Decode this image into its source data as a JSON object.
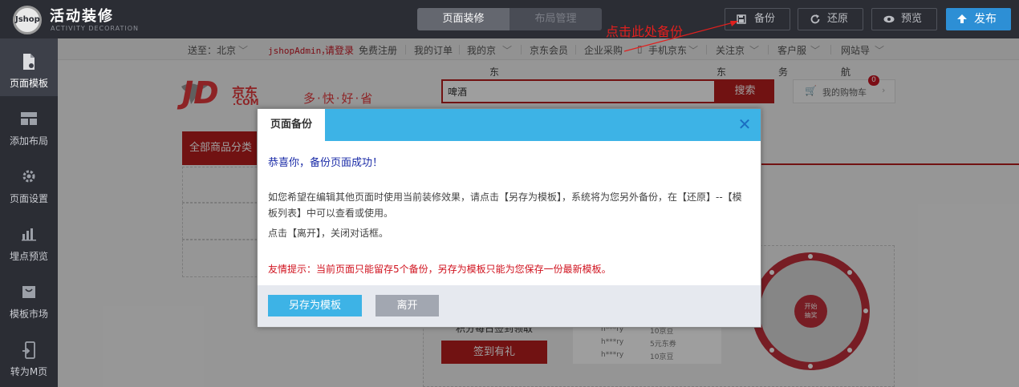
{
  "app": {
    "logo_text": "Jshop",
    "title": "活动装修",
    "subtitle": "ACTIVITY DECORATION"
  },
  "mode_tabs": [
    {
      "label": "页面装修",
      "active": true
    },
    {
      "label": "布局管理",
      "active": false
    }
  ],
  "toolbar": {
    "backup_label": "备份",
    "restore_label": "还原",
    "preview_label": "预览",
    "publish_label": "发布"
  },
  "annotation": "点击此处备份",
  "sidebar": {
    "items": [
      {
        "label": "页面模板",
        "icon": "page-template-icon",
        "active": true
      },
      {
        "label": "添加布局",
        "icon": "add-layout-icon",
        "active": false
      },
      {
        "label": "页面设置",
        "icon": "gear-icon",
        "active": false
      },
      {
        "label": "埋点预览",
        "icon": "bar-chart-icon",
        "active": false
      },
      {
        "label": "模板市场",
        "icon": "shop-bag-icon",
        "active": false
      },
      {
        "label": "转为M页",
        "icon": "mobile-convert-icon",
        "active": false
      }
    ]
  },
  "jd": {
    "topnav": {
      "ship_to": "送至：北京",
      "user": "jshopAdmin，",
      "login": "请登录",
      "register": "免费注册",
      "orders": "我的订单",
      "my_jd": "我的京",
      "dong": "东",
      "member": "京东会员",
      "enterprise": "企业采购",
      "mobile": "手机京东",
      "follow": "关注京",
      "service": "客户服",
      "nav": "网站导",
      "wu": "务",
      "hang": "航"
    },
    "logo": "JD",
    "logo_cn": "京东",
    "logo_com": ".COM",
    "slogan": "多·快·好·省",
    "search_value": "啤酒",
    "search_button": "搜索",
    "cart_label": "我的购物车",
    "cart_count": "0",
    "all_categories": "全部商品分类",
    "checkin_title": "积分每日签到领取",
    "checkin_button": "签到有礼",
    "mini_rows": [
      {
        "user": "h***ry",
        "prize": "10京豆"
      },
      {
        "user": "h***ry",
        "prize": "5元东券"
      },
      {
        "user": "h***ry",
        "prize": "10京豆"
      }
    ],
    "wheel_label_1": "开始",
    "wheel_label_2": "抽奖"
  },
  "modal": {
    "tab_title": "页面备份",
    "success_msg": "恭喜你，备份页面成功！",
    "para1": "如您希望在编辑其他页面时使用当前装修效果，请点击【另存为模板】，系统将为您另外备份，在【还原】--【模板列表】中可以查看或使用。",
    "para2": "点击【离开】，关闭对话框。",
    "tip": "友情提示：当前页面只能留存5个备份，另存为模板只能为您保存一份最新模板。",
    "save_as_template": "另存为模板",
    "leave": "离开"
  },
  "colors": {
    "topbar_bg": "#2b2d34",
    "publish_blue": "#2d8fd5",
    "modal_header": "#3db3e6",
    "jd_red": "#b61d1d",
    "annotation_red": "#e0201e",
    "tip_red": "#d0121e",
    "success_blue": "#1a2ba7"
  }
}
